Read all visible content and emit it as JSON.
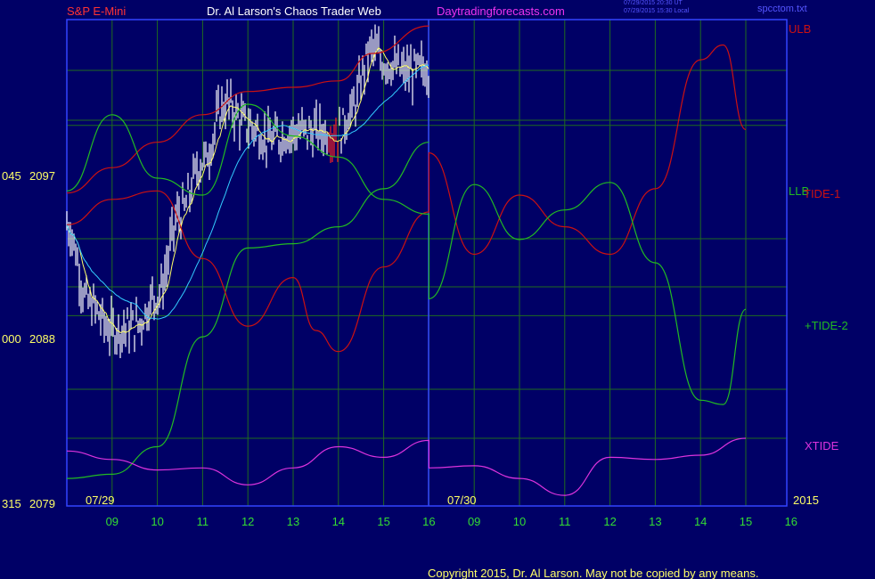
{
  "header": {
    "symbol": "S&P E-Mini",
    "site": "Dr. Al Larson's Chaos Trader Web",
    "url": "Daytradingforecasts.com",
    "stamp_ut": "07/29/2015 20:30 UT",
    "stamp_local": "07/29/2015 15:30 Local",
    "file": "spcctom.txt"
  },
  "footer": {
    "copyright": "Copyright 2015, Dr. Al Larson. May not be copied by any means."
  },
  "colors": {
    "background": "#000066",
    "frame": "#3344ff",
    "grid": "#1f6b1f",
    "ulb": "#cc1111",
    "llb": "#22bb22",
    "xtide": "#dd33dd",
    "price": "#ffffff",
    "ma_fast": "#ffff66",
    "ma_slow": "#33ccff",
    "hour_labels": "#33dd33",
    "price_labels": "#ffff66"
  },
  "chart_data": {
    "type": "line",
    "title": "S&P E-Mini",
    "y_axis": {
      "ticks": [
        {
          "left": "045",
          "value": "2097"
        },
        {
          "left": "000",
          "value": "2088"
        },
        {
          "left": "315",
          "value": "2079"
        }
      ],
      "ylim": [
        2079,
        2102
      ]
    },
    "x_axis": {
      "hour_ticks": [
        "09",
        "10",
        "11",
        "12",
        "13",
        "14",
        "15",
        "16",
        "09",
        "10",
        "11",
        "12",
        "13",
        "14",
        "15",
        "16"
      ],
      "date_labels": [
        "07/29",
        "07/30"
      ],
      "year": "2015"
    },
    "series": [
      {
        "name": "ULB",
        "label_color": "#cc1111",
        "values": [
          [
            "07/29 08:00",
            2093.8
          ],
          [
            "07/29 09:00",
            2095.0
          ],
          [
            "07/29 10:00",
            2096.2
          ],
          [
            "07/29 11:00",
            2097.5
          ],
          [
            "07/29 12:00",
            2098.6
          ],
          [
            "07/29 13:00",
            2098.8
          ],
          [
            "07/29 14:00",
            2099.1
          ],
          [
            "07/29 14:45",
            2100.4
          ],
          [
            "07/29 16:00",
            2101.7
          ]
        ]
      },
      {
        "name": "LLB",
        "label_color": "#22bb22",
        "values": [
          [
            "07/29 08:00",
            2080.3
          ],
          [
            "07/29 09:00",
            2080.5
          ],
          [
            "07/29 10:00",
            2081.8
          ],
          [
            "07/29 11:00",
            2087.0
          ],
          [
            "07/29 12:00",
            2091.2
          ],
          [
            "07/29 13:00",
            2091.4
          ],
          [
            "07/29 14:00",
            2092.2
          ],
          [
            "07/29 15:00",
            2094.0
          ],
          [
            "07/29 16:00",
            2096.2
          ]
        ]
      },
      {
        "name": "TIDE-1",
        "label_color": "#cc1111",
        "values": [
          [
            "07/29 08:00",
            2092.3
          ],
          [
            "07/29 09:00",
            2093.5
          ],
          [
            "07/29 10:00",
            2093.9
          ],
          [
            "07/29 11:00",
            2090.7
          ],
          [
            "07/29 12:00",
            2087.5
          ],
          [
            "07/29 13:00",
            2089.8
          ],
          [
            "07/29 13:30",
            2087.3
          ],
          [
            "07/29 14:00",
            2086.3
          ],
          [
            "07/29 15:00",
            2090.3
          ],
          [
            "07/29 16:00",
            2092.9
          ],
          [
            "07/30 09:00",
            2095.7
          ],
          [
            "07/30 10:00",
            2090.9
          ],
          [
            "07/30 11:00",
            2093.7
          ],
          [
            "07/30 12:00",
            2092.2
          ],
          [
            "07/30 13:00",
            2090.9
          ],
          [
            "07/30 14:00",
            2094.0
          ],
          [
            "07/30 15:00",
            2100.1
          ],
          [
            "07/30 15:30",
            2100.8
          ],
          [
            "07/30 16:00",
            2096.8
          ]
        ]
      },
      {
        "name": "+TIDE-2",
        "label_color": "#22bb22",
        "values": [
          [
            "07/29 08:00",
            2093.9
          ],
          [
            "07/29 09:00",
            2097.5
          ],
          [
            "07/29 10:00",
            2094.5
          ],
          [
            "07/29 11:00",
            2093.7
          ],
          [
            "07/29 12:00",
            2098.0
          ],
          [
            "07/29 13:00",
            2096.5
          ],
          [
            "07/29 14:00",
            2095.5
          ],
          [
            "07/29 15:00",
            2093.5
          ],
          [
            "07/29 16:00",
            2092.8
          ],
          [
            "07/30 09:00",
            2088.8
          ],
          [
            "07/30 10:00",
            2094.2
          ],
          [
            "07/30 11:00",
            2091.6
          ],
          [
            "07/30 12:00",
            2093.0
          ],
          [
            "07/30 13:00",
            2094.3
          ],
          [
            "07/30 14:00",
            2090.5
          ],
          [
            "07/30 15:00",
            2084.0
          ],
          [
            "07/30 15:30",
            2083.8
          ],
          [
            "07/30 16:00",
            2088.3
          ]
        ]
      },
      {
        "name": "XTIDE",
        "label_color": "#dd33dd",
        "values": [
          [
            "07/29 08:00",
            2081.6
          ],
          [
            "07/29 09:00",
            2081.2
          ],
          [
            "07/29 10:00",
            2080.7
          ],
          [
            "07/29 11:00",
            2080.8
          ],
          [
            "07/29 12:00",
            2080.0
          ],
          [
            "07/29 13:00",
            2080.8
          ],
          [
            "07/29 14:00",
            2081.8
          ],
          [
            "07/29 15:00",
            2081.3
          ],
          [
            "07/29 16:00",
            2082.1
          ],
          [
            "07/30 09:00",
            2080.8
          ],
          [
            "07/30 10:00",
            2080.9
          ],
          [
            "07/30 11:00",
            2080.3
          ],
          [
            "07/30 12:00",
            2079.5
          ],
          [
            "07/30 13:00",
            2081.3
          ],
          [
            "07/30 14:00",
            2081.2
          ],
          [
            "07/30 15:00",
            2081.4
          ],
          [
            "07/30 16:00",
            2082.2
          ]
        ]
      },
      {
        "name": "",
        "values": [
          [
            "07/29 08:00",
            2092.3
          ],
          [
            "07/29 08:30",
            2088.5
          ],
          [
            "07/29 09:00",
            2087.3
          ],
          [
            "07/29 09:30",
            2087.5
          ],
          [
            "07/29 10:00",
            2089.0
          ],
          [
            "07/29 10:30",
            2092.8
          ],
          [
            "07/29 11:00",
            2095.3
          ],
          [
            "07/29 11:30",
            2098.0
          ],
          [
            "07/29 12:00",
            2097.0
          ],
          [
            "07/29 12:30",
            2096.3
          ],
          [
            "07/29 13:00",
            2096.7
          ],
          [
            "07/29 13:30",
            2096.7
          ],
          [
            "07/29 14:00",
            2096.6
          ],
          [
            "07/29 14:15",
            2097.6
          ],
          [
            "07/29 14:45",
            2100.6
          ],
          [
            "07/29 15:00",
            2100.0
          ],
          [
            "07/29 15:30",
            2099.5
          ],
          [
            "07/29 16:00",
            2099.7
          ]
        ]
      }
    ]
  }
}
